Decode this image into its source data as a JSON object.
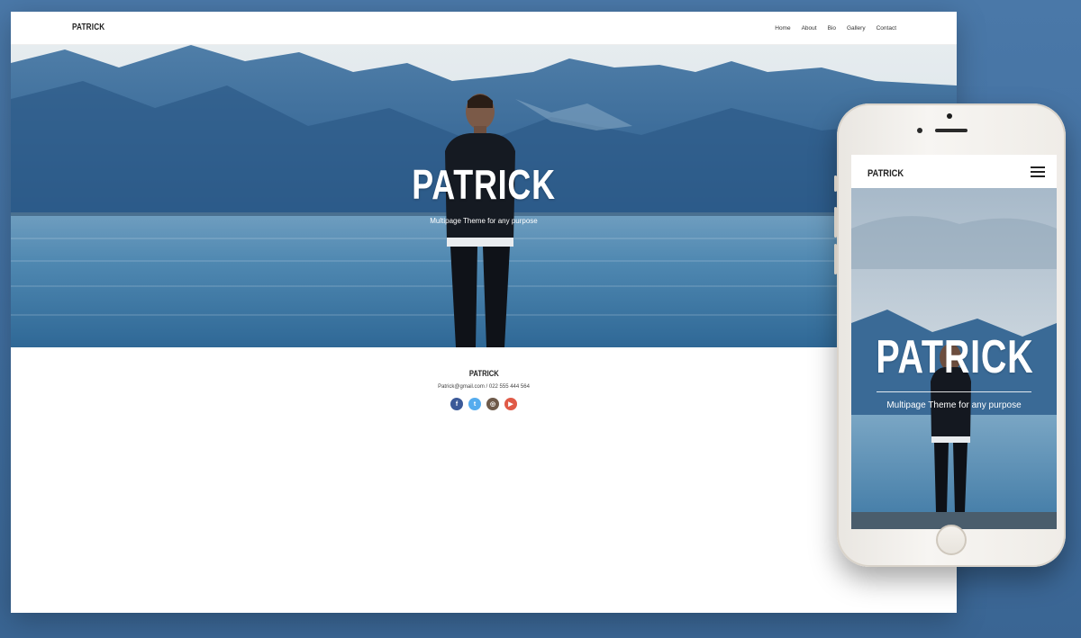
{
  "desktop": {
    "nav": {
      "logo": "PATRICK",
      "menu": [
        "Home",
        "About",
        "Bio",
        "Gallery",
        "Contact"
      ]
    },
    "hero": {
      "title": "PATRICK",
      "subtitle": "Multipage Theme for any purpose"
    },
    "footer": {
      "name": "PATRICK",
      "contact": "Patrick@gmail.com / 022 555 444 564",
      "social": [
        {
          "icon": "facebook-icon",
          "glyph": "f",
          "color": "#3b5998"
        },
        {
          "icon": "twitter-icon",
          "glyph": "t",
          "color": "#55acee"
        },
        {
          "icon": "instagram-icon",
          "glyph": "◎",
          "color": "#6e5a4a"
        },
        {
          "icon": "youtube-icon",
          "glyph": "▶",
          "color": "#e05a47"
        }
      ]
    }
  },
  "mobile": {
    "nav": {
      "logo": "PATRICK",
      "menu_icon": "hamburger-icon"
    },
    "hero": {
      "title": "PATRICK",
      "subtitle": "Multipage Theme for any purpose"
    }
  },
  "colors": {
    "background": "#4a78a8",
    "water": "#4d86ad",
    "mountains": "#2f5f8e"
  }
}
